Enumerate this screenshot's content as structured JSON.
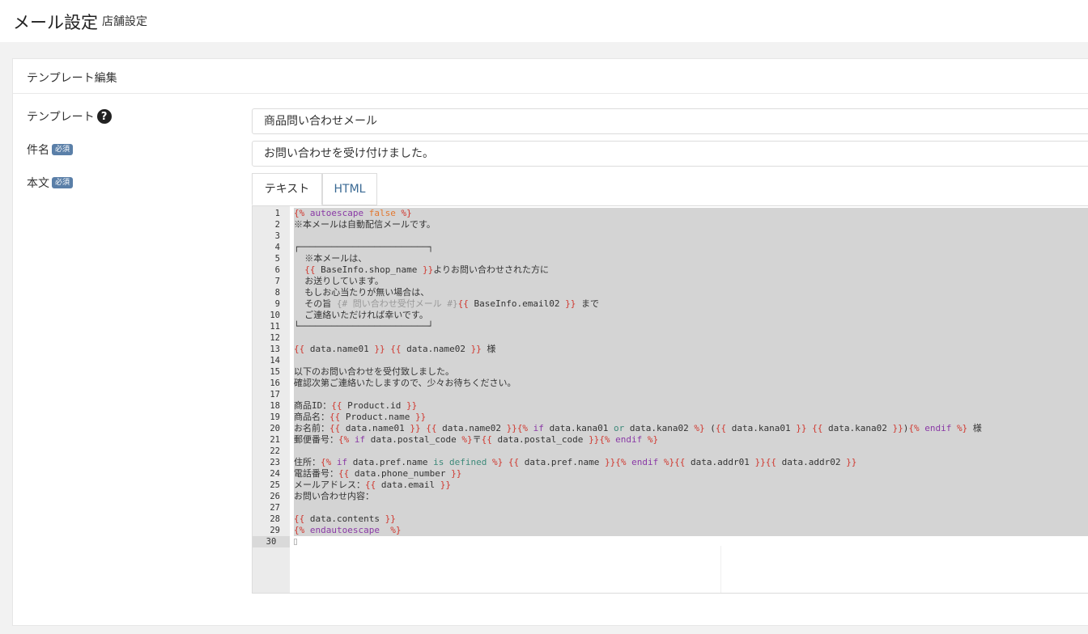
{
  "header": {
    "title": "メール設定",
    "subtitle": "店舗設定"
  },
  "card": {
    "title": "テンプレート編集"
  },
  "form": {
    "template_label": "テンプレート",
    "template_value": "商品問い合わせメール",
    "subject_label": "件名",
    "subject_badge": "必須",
    "subject_value": "お問い合わせを受け付けました。",
    "body_label": "本文",
    "body_badge": "必須"
  },
  "tabs": [
    {
      "label": "テキスト"
    },
    {
      "label": "HTML"
    }
  ],
  "icons": {
    "help": "question-circle-icon"
  },
  "colors": {
    "badge": "#5a7fa8",
    "tab_link": "#3b6a94",
    "twig_delim": "#d0372e",
    "twig_keyword": "#8a3aa6"
  },
  "editor": {
    "line_numbers": [
      "1",
      "2",
      "3",
      "4",
      "5",
      "6",
      "7",
      "8",
      "9",
      "10",
      "11",
      "12",
      "13",
      "14",
      "15",
      "16",
      "17",
      "18",
      "19",
      "20",
      "21",
      "22",
      "23",
      "24",
      "25",
      "26",
      "27",
      "28",
      "29",
      "30"
    ],
    "lines": [
      [
        [
          "d",
          "{%"
        ],
        [
          "k",
          " autoescape "
        ],
        [
          "b",
          "false"
        ],
        [
          "d",
          " %}"
        ]
      ],
      [
        [
          "v",
          "※本メールは自動配信メールです。"
        ]
      ],
      [],
      [
        [
          "v",
          "┌────────────────────────┐"
        ]
      ],
      [
        [
          "v",
          "  ※本メールは、"
        ]
      ],
      [
        [
          "d",
          "  {{"
        ],
        [
          "v",
          " BaseInfo.shop_name "
        ],
        [
          "d",
          "}}"
        ],
        [
          "v",
          "よりお問い合わせされた方に"
        ]
      ],
      [
        [
          "v",
          "  お送りしています。"
        ]
      ],
      [
        [
          "v",
          "  もしお心当たりが無い場合は、"
        ]
      ],
      [
        [
          "v",
          "  その旨 "
        ],
        [
          "cm",
          "{# 問い合わせ受付メール #}"
        ],
        [
          "d",
          "{{"
        ],
        [
          "v",
          " BaseInfo.email02 "
        ],
        [
          "d",
          "}}"
        ],
        [
          "v",
          " まで"
        ]
      ],
      [
        [
          "v",
          "  ご連絡いただければ幸いです。"
        ]
      ],
      [
        [
          "v",
          "└────────────────────────┘"
        ]
      ],
      [],
      [
        [
          "d",
          "{{"
        ],
        [
          "v",
          " data.name01 "
        ],
        [
          "d",
          "}}"
        ],
        [
          "v",
          " "
        ],
        [
          "d",
          "{{"
        ],
        [
          "v",
          " data.name02 "
        ],
        [
          "d",
          "}}"
        ],
        [
          "v",
          " 様"
        ]
      ],
      [],
      [
        [
          "v",
          "以下のお問い合わせを受付致しました。"
        ]
      ],
      [
        [
          "v",
          "確認次第ご連絡いたしますので、少々お待ちください。"
        ]
      ],
      [],
      [
        [
          "v",
          "商品ID："
        ],
        [
          "d",
          "{{"
        ],
        [
          "v",
          " Product.id "
        ],
        [
          "d",
          "}}"
        ]
      ],
      [
        [
          "v",
          "商品名："
        ],
        [
          "d",
          "{{"
        ],
        [
          "v",
          " Product.name "
        ],
        [
          "d",
          "}}"
        ]
      ],
      [
        [
          "v",
          "お名前："
        ],
        [
          "d",
          "{{"
        ],
        [
          "v",
          " data.name01 "
        ],
        [
          "d",
          "}}"
        ],
        [
          "v",
          " "
        ],
        [
          "d",
          "{{"
        ],
        [
          "v",
          " data.name02 "
        ],
        [
          "d",
          "}}"
        ],
        [
          "d",
          "{%"
        ],
        [
          "k",
          " if "
        ],
        [
          "v",
          "data.kana01 "
        ],
        [
          "o",
          "or"
        ],
        [
          "v",
          " data.kana02 "
        ],
        [
          "d",
          "%}"
        ],
        [
          "v",
          " ("
        ],
        [
          "d",
          "{{"
        ],
        [
          "v",
          " data.kana01 "
        ],
        [
          "d",
          "}}"
        ],
        [
          "v",
          " "
        ],
        [
          "d",
          "{{"
        ],
        [
          "v",
          " data.kana02 "
        ],
        [
          "d",
          "}}"
        ],
        [
          "v",
          ")"
        ],
        [
          "d",
          "{%"
        ],
        [
          "k",
          " endif "
        ],
        [
          "d",
          "%}"
        ],
        [
          "v",
          " 様"
        ]
      ],
      [
        [
          "v",
          "郵便番号："
        ],
        [
          "d",
          "{%"
        ],
        [
          "k",
          " if "
        ],
        [
          "v",
          "data.postal_code "
        ],
        [
          "d",
          "%}"
        ],
        [
          "v",
          "〒"
        ],
        [
          "d",
          "{{"
        ],
        [
          "v",
          " data.postal_code "
        ],
        [
          "d",
          "}}"
        ],
        [
          "d",
          "{%"
        ],
        [
          "k",
          " endif "
        ],
        [
          "d",
          "%}"
        ]
      ],
      [],
      [
        [
          "v",
          "住所："
        ],
        [
          "d",
          "{%"
        ],
        [
          "k",
          " if "
        ],
        [
          "v",
          "data.pref.name "
        ],
        [
          "o",
          "is defined"
        ],
        [
          "v",
          " "
        ],
        [
          "d",
          "%}"
        ],
        [
          "v",
          " "
        ],
        [
          "d",
          "{{"
        ],
        [
          "v",
          " data.pref.name "
        ],
        [
          "d",
          "}}"
        ],
        [
          "d",
          "{%"
        ],
        [
          "k",
          " endif "
        ],
        [
          "d",
          "%}"
        ],
        [
          "d",
          "{{"
        ],
        [
          "v",
          " data.addr01 "
        ],
        [
          "d",
          "}}"
        ],
        [
          "d",
          "{{"
        ],
        [
          "v",
          " data.addr02 "
        ],
        [
          "d",
          "}}"
        ]
      ],
      [
        [
          "v",
          "電話番号："
        ],
        [
          "d",
          "{{"
        ],
        [
          "v",
          " data.phone_number "
        ],
        [
          "d",
          "}}"
        ]
      ],
      [
        [
          "v",
          "メールアドレス："
        ],
        [
          "d",
          "{{"
        ],
        [
          "v",
          " data.email "
        ],
        [
          "d",
          "}}"
        ]
      ],
      [
        [
          "v",
          "お問い合わせ内容："
        ]
      ],
      [],
      [
        [
          "d",
          "{{"
        ],
        [
          "v",
          " data.contents "
        ],
        [
          "d",
          "}}"
        ]
      ],
      [
        [
          "d",
          "{%"
        ],
        [
          "k",
          " endautoescape  "
        ],
        [
          "d",
          "%}"
        ]
      ],
      []
    ]
  }
}
